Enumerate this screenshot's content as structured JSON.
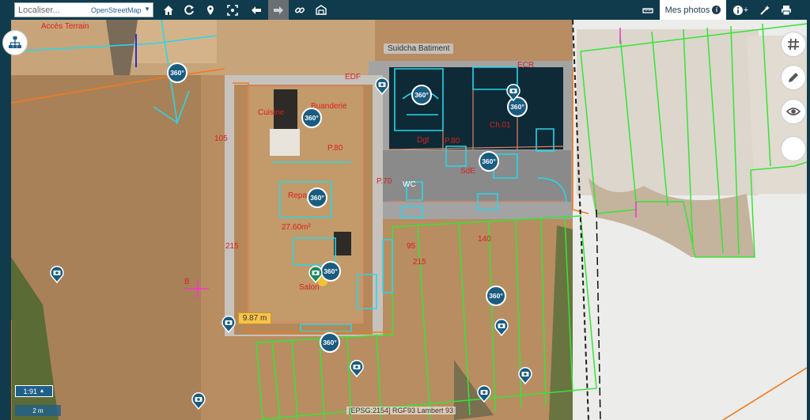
{
  "toolbar": {
    "search_placeholder": "Localiser...",
    "provider": "OpenStreetMap",
    "photos_tab": "Mes photos",
    "info_badge": "i",
    "plus_label": "+"
  },
  "map": {
    "tooltip": "Suidcha Batiment",
    "measure_label": "9.87 m",
    "scale_ratio": "1:91",
    "scale_bar": "2 m",
    "coord_system": "[EPSG:2154] RGF93 Lambert 93",
    "labels": {
      "acces": "Accès Terrain",
      "edf": "EDF",
      "cuisine": "Cuisine",
      "buanderie": "Buanderie",
      "p80a": "P.80",
      "p80b": "P.80",
      "p70": "P.70",
      "repas": "Repas",
      "surface": "27.60m²",
      "salon": "Salon",
      "b1": "B",
      "n105": "105",
      "n215a": "215",
      "n215b": "215",
      "n95": "95",
      "n140": "140",
      "wc": "WC",
      "sde": "SdE",
      "ch01": "Ch.01",
      "dgt": "Dgt",
      "ecr": "ECR"
    },
    "pano_label": "360°"
  },
  "colors": {
    "topbar": "#0f3b4c",
    "accent": "#1f5f8b",
    "plan_cyan": "#27d8e8",
    "plot_green": "#35e535",
    "wall_gray": "#a3a3a3",
    "label_red": "#d8201e"
  }
}
